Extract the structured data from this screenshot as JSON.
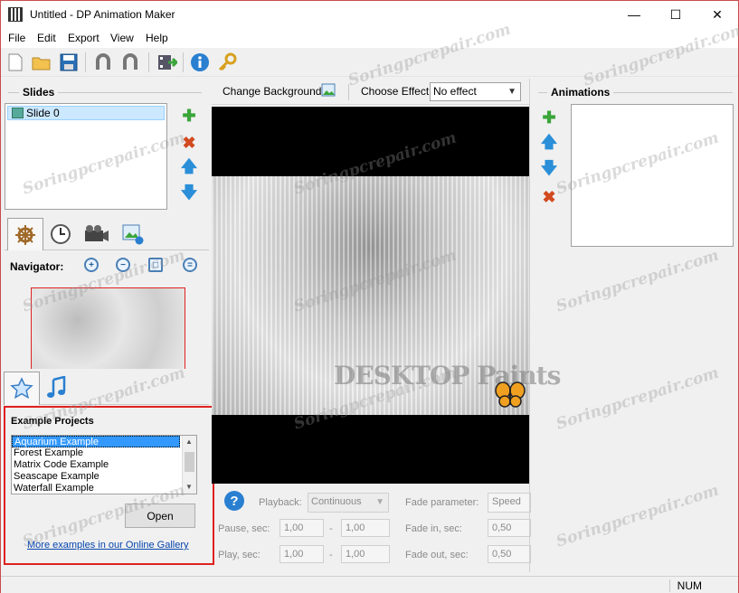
{
  "window": {
    "title": "Untitled - DP Animation Maker"
  },
  "menu": [
    "File",
    "Edit",
    "Export",
    "View",
    "Help"
  ],
  "slides": {
    "header": "Slides",
    "items": [
      "Slide 0"
    ]
  },
  "navigator": {
    "label": "Navigator:"
  },
  "examples": {
    "header": "Example Projects",
    "items": [
      "Aquarium Example",
      "Forest Example",
      "Matrix Code Example",
      "Seascape Example",
      "Waterfall Example"
    ],
    "selected": "Aquarium Example",
    "open_label": "Open",
    "gallery_link": "More examples in our Online Gallery"
  },
  "canvas_toolbar": {
    "change_background": "Change Background",
    "choose_effect_label": "Choose Effect:",
    "effect_value": "No effect"
  },
  "animations": {
    "header": "Animations"
  },
  "params": {
    "playback_label": "Playback:",
    "playback_value": "Continuous",
    "pause_label": "Pause, sec:",
    "pause_from": "1,00",
    "pause_to": "1,00",
    "play_label": "Play, sec:",
    "play_from": "1,00",
    "play_to": "1,00",
    "fade_param_label": "Fade parameter:",
    "fade_param_value": "Speed",
    "fade_in_label": "Fade in, sec:",
    "fade_in_value": "0,50",
    "fade_out_label": "Fade out, sec:",
    "fade_out_value": "0,50",
    "dash": "-"
  },
  "canvas_logo": "DESKTOP Paints",
  "status": {
    "num": "NUM"
  },
  "watermark": "Soringpcrepair.com",
  "colors": {
    "highlight_border": "#e02020",
    "selection": "#3399ff",
    "link": "#0645ad"
  }
}
